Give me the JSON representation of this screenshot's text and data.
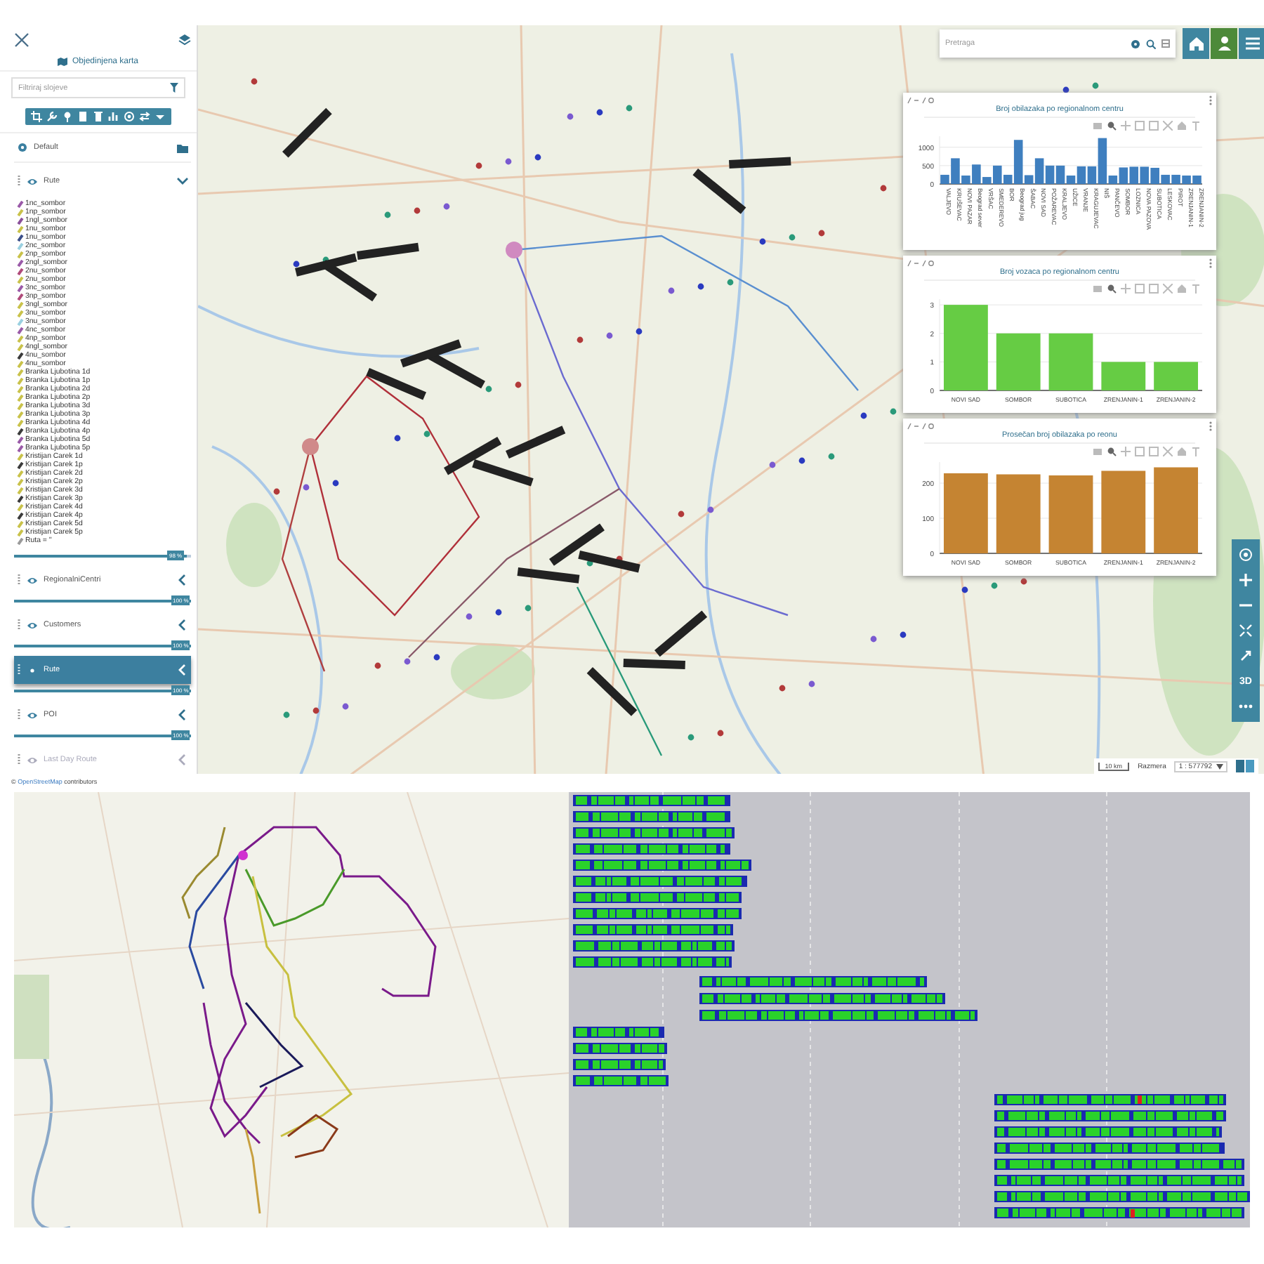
{
  "sidebar": {
    "title": "Objedinjena karta",
    "filter": {
      "placeholder": "Filtriraj slojeve"
    },
    "layers": [
      {
        "kind": "group",
        "name": "Default"
      },
      {
        "kind": "layer",
        "name": "Rute",
        "expanded": true,
        "selected": false,
        "disabled": false,
        "level": 0.98,
        "reading": "98 %",
        "items": [
          {
            "label": "1nc_sombor",
            "color": "#9a5aa8"
          },
          {
            "label": "1np_sombor",
            "color": "#c9c24a"
          },
          {
            "label": "1ngl_sombor",
            "color": "#8a4f9a"
          },
          {
            "label": "1nu_sombor",
            "color": "#c9c24a"
          },
          {
            "label": "1nu_sombor",
            "color": "#3b4f8a"
          },
          {
            "label": "2nc_sombor",
            "color": "#9ad0e0"
          },
          {
            "label": "2np_sombor",
            "color": "#c9c24a"
          },
          {
            "label": "2ngl_sombor",
            "color": "#9a5aa8"
          },
          {
            "label": "2nu_sombor",
            "color": "#b04a7a"
          },
          {
            "label": "2nu_sombor",
            "color": "#c9c24a"
          },
          {
            "label": "3nc_sombor",
            "color": "#9a5aa8"
          },
          {
            "label": "3np_sombor",
            "color": "#b04a7a"
          },
          {
            "label": "3ngl_sombor",
            "color": "#c9c24a"
          },
          {
            "label": "3nu_sombor",
            "color": "#c9c24a"
          },
          {
            "label": "3nu_sombor",
            "color": "#9ad0e0"
          },
          {
            "label": "4nc_sombor",
            "color": "#9a5aa8"
          },
          {
            "label": "4np_sombor",
            "color": "#c9c24a"
          },
          {
            "label": "4ngl_sombor",
            "color": "#c9c24a"
          },
          {
            "label": "4nu_sombor",
            "color": "#3a3a3a"
          },
          {
            "label": "4nu_sombor",
            "color": "#c9c24a"
          },
          {
            "label": "Branka Ljubotina 1d",
            "color": "#c9c24a"
          },
          {
            "label": "Branka Ljubotina 1p",
            "color": "#c9c24a"
          },
          {
            "label": "Branka Ljubotina 2d",
            "color": "#c9c24a"
          },
          {
            "label": "Branka Ljubotina 2p",
            "color": "#c9c24a"
          },
          {
            "label": "Branka Ljubotina 3d",
            "color": "#c9c24a"
          },
          {
            "label": "Branka Ljubotina 3p",
            "color": "#c9c24a"
          },
          {
            "label": "Branka Ljubotina 4d",
            "color": "#c9c24a"
          },
          {
            "label": "Branka Ljubotina 4p",
            "color": "#3a3a3a"
          },
          {
            "label": "Branka Ljubotina 5d",
            "color": "#9a5aa8"
          },
          {
            "label": "Branka Ljubotina 5p",
            "color": "#9a5aa8"
          },
          {
            "label": "Kristijan Carek 1d",
            "color": "#c9c24a"
          },
          {
            "label": "Kristijan Carek 1p",
            "color": "#3a3a3a"
          },
          {
            "label": "Kristijan Carek 2d",
            "color": "#c9c24a"
          },
          {
            "label": "Kristijan Carek 2p",
            "color": "#c9c24a"
          },
          {
            "label": "Kristijan Carek 3d",
            "color": "#c9c24a"
          },
          {
            "label": "Kristijan Carek 3p",
            "color": "#3a3a3a"
          },
          {
            "label": "Kristijan Carek 4d",
            "color": "#c9c24a"
          },
          {
            "label": "Kristijan Carek 4p",
            "color": "#3a3a3a"
          },
          {
            "label": "Kristijan Carek 5d",
            "color": "#c9c24a"
          },
          {
            "label": "Kristijan Carek 5p",
            "color": "#c9c24a"
          },
          {
            "label": "Ruta = ''",
            "color": "#9a9a9a"
          }
        ]
      },
      {
        "kind": "layer",
        "name": "RegionalniCentri",
        "expanded": false,
        "selected": false,
        "disabled": false,
        "level": 1,
        "reading": "100 %"
      },
      {
        "kind": "layer",
        "name": "Customers",
        "expanded": false,
        "selected": false,
        "disabled": false,
        "level": 1,
        "reading": "100 %"
      },
      {
        "kind": "layer",
        "name": "Rute",
        "expanded": false,
        "selected": true,
        "disabled": false,
        "level": 1,
        "reading": "100 %"
      },
      {
        "kind": "layer",
        "name": "POI",
        "expanded": false,
        "selected": false,
        "disabled": false,
        "level": 1,
        "reading": "100 %"
      },
      {
        "kind": "layer",
        "name": "Last Day Route",
        "expanded": false,
        "selected": false,
        "disabled": true
      }
    ],
    "attribution": {
      "prefix": "©",
      "link": "OpenStreetMap",
      "suffix": "contributors"
    }
  },
  "map": {
    "search": {
      "placeholder": "Pretraga"
    },
    "top_buttons": [
      {
        "kind": "home",
        "selected": false
      },
      {
        "kind": "user",
        "selected": true
      },
      {
        "kind": "menu",
        "selected": false
      }
    ],
    "controls": [
      {
        "kind": "compass"
      },
      {
        "kind": "zoom-in"
      },
      {
        "kind": "zoom-out"
      },
      {
        "kind": "fit"
      },
      {
        "kind": "fullscreen"
      },
      {
        "kind": "text",
        "label": "3D"
      },
      {
        "kind": "more"
      }
    ],
    "scale": {
      "distance": "10 km",
      "label": "Razmera",
      "value": "1 : 577792"
    },
    "charts": [
      {
        "chart_data": {
          "type": "bar",
          "title": "Broj obilazaka po regionalnom centru",
          "categories": [
            "VALJEVO",
            "KRUŠEVAC",
            "NOVI PAZAR",
            "Beograd sever",
            "VRŠAC",
            "SMEDEREVO",
            "BOR",
            "Beograd jug",
            "ŠABAC",
            "NOVI SAD",
            "POŽAREVAC",
            "KRALJEVO",
            "UŽICE",
            "VRANJE",
            "KRAGUJEVAC",
            "NIŠ",
            "PANČEVO",
            "SOMBOR",
            "LOZNICA",
            "NOVA PAZOVA",
            "SUBOTICA",
            "LESKOVAC",
            "PIROT",
            "ZRENJANIN-1",
            "ZRENJANIN-2"
          ],
          "series": [
            {
              "color": "#3f7fbf",
              "values": [
                250,
                700,
                230,
                530,
                190,
                500,
                250,
                1200,
                240,
                700,
                500,
                500,
                230,
                480,
                480,
                1250,
                230,
                450,
                470,
                470,
                440,
                250,
                250,
                230,
                230
              ]
            }
          ],
          "ylim": [
            0,
            1300
          ],
          "yticks": [
            0,
            500,
            1000
          ],
          "grid": true
        }
      },
      {
        "chart_data": {
          "type": "bar",
          "title": "Broj vozaca po regionalnom centru",
          "categories": [
            "NOVI SAD",
            "SOMBOR",
            "SUBOTICA",
            "ZRENJANIN-1",
            "ZRENJANIN-2"
          ],
          "series": [
            {
              "color": "#66cc44",
              "values": [
                3,
                2,
                2,
                1,
                1
              ]
            }
          ],
          "ylim": [
            0,
            3.2
          ],
          "yticks": [
            0,
            1,
            2,
            3
          ],
          "grid": true
        }
      },
      {
        "chart_data": {
          "type": "bar",
          "title": "Prosečan broj obilazaka po reonu",
          "categories": [
            "NOVI SAD",
            "SOMBOR",
            "SUBOTICA",
            "ZRENJANIN-1",
            "ZRENJANIN-2"
          ],
          "series": [
            {
              "color": "#c58432",
              "values": [
                228,
                225,
                222,
                235,
                245
              ]
            }
          ],
          "ylim": [
            0,
            260
          ],
          "yticks": [
            0,
            100,
            200
          ],
          "grid": true
        }
      }
    ]
  }
}
